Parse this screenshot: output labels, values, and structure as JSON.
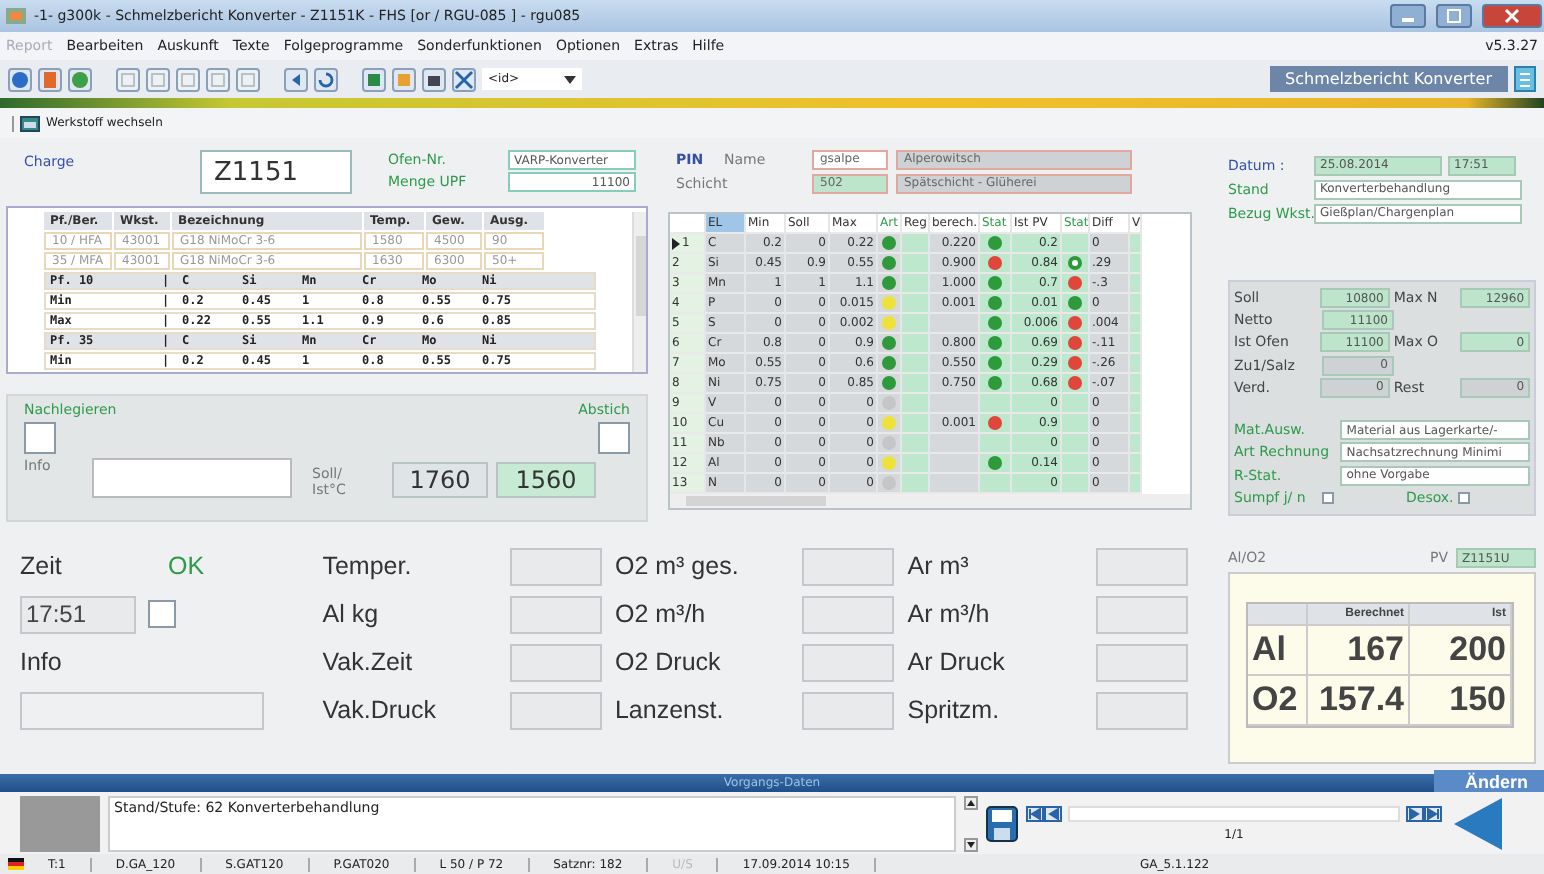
{
  "window": {
    "title": "-1- g300k - Schmelzbericht Konverter - Z1151K -   FHS [or / RGU-085 ]  -  rgu085",
    "version": "v5.3.27"
  },
  "menu": [
    {
      "label": "Report",
      "disabled": true
    },
    {
      "label": "Bearbeiten",
      "disabled": false
    },
    {
      "label": "Auskunft",
      "disabled": false
    },
    {
      "label": "Texte",
      "disabled": false
    },
    {
      "label": "Folgeprogramme",
      "disabled": false
    },
    {
      "label": "Sonderfunktionen",
      "disabled": false
    },
    {
      "label": "Optionen",
      "disabled": false
    },
    {
      "label": "Extras",
      "disabled": false
    },
    {
      "label": "Hilfe",
      "disabled": false
    }
  ],
  "toolbar": {
    "id_field": "<id>",
    "module_title": "Schmelzbericht Konverter"
  },
  "werkstoff_button": "Werkstoff wechseln",
  "charge": {
    "label": "Charge",
    "value": "Z1151",
    "ofen_label": "Ofen-Nr.",
    "ofen": "VARP-Konverter",
    "menge_label": "Menge UPF",
    "menge": "11100"
  },
  "spec_table": {
    "columns": [
      "Pf./Ber.",
      "Wkst.",
      "Bezeichnung",
      "Temp.",
      "Gew.",
      "Ausg."
    ],
    "rows": [
      [
        "10 / HFA",
        "43001",
        "G18 NiMoCr 3-6",
        "1580",
        "4500",
        "90"
      ],
      [
        "35 / MFA",
        "43001",
        "G18 NiMoCr 3-6",
        "1630",
        "6300",
        "50+"
      ]
    ]
  },
  "analysis_lines": [
    {
      "kind": "header",
      "label": "Pf. 10",
      "divider": "|",
      "values": [
        "C",
        "Si",
        "Mn",
        "Cr",
        "Mo",
        "Ni"
      ]
    },
    {
      "kind": "value",
      "label": "Min",
      "divider": "|",
      "values": [
        "0.2",
        "0.45",
        "1",
        "0.8",
        "0.55",
        "0.75"
      ]
    },
    {
      "kind": "value",
      "label": "Max",
      "divider": "|",
      "values": [
        "0.22",
        "0.55",
        "1.1",
        "0.9",
        "0.6",
        "0.85"
      ]
    },
    {
      "kind": "header",
      "label": "Pf. 35",
      "divider": "|",
      "values": [
        "C",
        "Si",
        "Mn",
        "Cr",
        "Mo",
        "Ni"
      ]
    },
    {
      "kind": "value",
      "label": "Min",
      "divider": "|",
      "values": [
        "0.2",
        "0.45",
        "1",
        "0.8",
        "0.55",
        "0.75"
      ]
    }
  ],
  "alloy_panel": {
    "nachlegieren": "Nachlegieren",
    "nachlegieren_checked": false,
    "abstich": "Abstich",
    "abstich_checked": false,
    "info_label": "Info",
    "temp_label_1": "Soll/",
    "temp_label_2": "Ist°C",
    "soll": "1760",
    "ist": "1560"
  },
  "pin": {
    "label": "PIN",
    "name_label": "Name",
    "user": "gsalpe",
    "name": "Alperowitsch",
    "schicht_label": "Schicht",
    "schicht_code": "502",
    "schicht": "Spätschicht - Glüherei"
  },
  "grid": {
    "columns": [
      "EL",
      "Min",
      "Soll",
      "Max",
      "Art",
      "Reg",
      "berech.",
      "Stat",
      "Ist PV",
      "Stat",
      "Diff",
      "V"
    ],
    "rows": [
      {
        "no": "1",
        "el": "C",
        "min": "0.2",
        "soll": "0",
        "max": "0.22",
        "art_lamp": {
          "color": "#2e9a3c",
          "hollow": false
        },
        "berech": "0.220",
        "calc_lamp": {
          "color": "#2e9a3c",
          "hollow": false
        },
        "ist": "0.2",
        "diff": "0",
        "current": true
      },
      {
        "no": "2",
        "el": "Si",
        "min": "0.45",
        "soll": "0.9",
        "max": "0.55",
        "art_lamp": {
          "color": "#2e9a3c",
          "hollow": false
        },
        "berech": "0.900",
        "calc_lamp": {
          "color": "#e0463c",
          "hollow": false
        },
        "ist": "0.84",
        "pv_lamp": {
          "color": "#2e9a3c",
          "hollow": true
        },
        "diff": ".29",
        "current": false
      },
      {
        "no": "3",
        "el": "Mn",
        "min": "1",
        "soll": "1",
        "max": "1.1",
        "art_lamp": {
          "color": "#2e9a3c",
          "hollow": false
        },
        "berech": "1.000",
        "calc_lamp": {
          "color": "#2e9a3c",
          "hollow": false
        },
        "ist": "0.7",
        "pv_lamp": {
          "color": "#e0463c",
          "hollow": false
        },
        "diff": "-.3",
        "current": false
      },
      {
        "no": "4",
        "el": "P",
        "min": "0",
        "soll": "0",
        "max": "0.015",
        "art_lamp": {
          "color": "#ece23a",
          "hollow": false
        },
        "berech": "0.001",
        "calc_lamp": {
          "color": "#2e9a3c",
          "hollow": false
        },
        "ist": "0.01",
        "pv_lamp": {
          "color": "#2e9a3c",
          "hollow": false
        },
        "diff": "0",
        "current": false
      },
      {
        "no": "5",
        "el": "S",
        "min": "0",
        "soll": "0",
        "max": "0.002",
        "art_lamp": {
          "color": "#ece23a",
          "hollow": false
        },
        "calc_lamp": {
          "color": "#2e9a3c",
          "hollow": false
        },
        "ist": "0.006",
        "pv_lamp": {
          "color": "#e0463c",
          "hollow": false
        },
        "diff": ".004",
        "current": false
      },
      {
        "no": "6",
        "el": "Cr",
        "min": "0.8",
        "soll": "0",
        "max": "0.9",
        "art_lamp": {
          "color": "#2e9a3c",
          "hollow": false
        },
        "berech": "0.800",
        "calc_lamp": {
          "color": "#2e9a3c",
          "hollow": false
        },
        "ist": "0.69",
        "pv_lamp": {
          "color": "#e0463c",
          "hollow": false
        },
        "diff": "-.11",
        "current": false
      },
      {
        "no": "7",
        "el": "Mo",
        "min": "0.55",
        "soll": "0",
        "max": "0.6",
        "art_lamp": {
          "color": "#2e9a3c",
          "hollow": false
        },
        "berech": "0.550",
        "calc_lamp": {
          "color": "#2e9a3c",
          "hollow": false
        },
        "ist": "0.29",
        "pv_lamp": {
          "color": "#e0463c",
          "hollow": false
        },
        "diff": "-.26",
        "current": false
      },
      {
        "no": "8",
        "el": "Ni",
        "min": "0.75",
        "soll": "0",
        "max": "0.85",
        "art_lamp": {
          "color": "#2e9a3c",
          "hollow": false
        },
        "berech": "0.750",
        "calc_lamp": {
          "color": "#2e9a3c",
          "hollow": false
        },
        "ist": "0.68",
        "pv_lamp": {
          "color": "#e0463c",
          "hollow": false
        },
        "diff": "-.07",
        "current": false
      },
      {
        "no": "9",
        "el": "V",
        "min": "0",
        "soll": "0",
        "max": "0",
        "art_lamp": {
          "color": "#c6c6c6",
          "hollow": false
        },
        "ist": "0",
        "diff": "0",
        "current": false
      },
      {
        "no": "10",
        "el": "Cu",
        "min": "0",
        "soll": "0",
        "max": "0",
        "art_lamp": {
          "color": "#ece23a",
          "hollow": false
        },
        "berech": "0.001",
        "calc_lamp": {
          "color": "#e0463c",
          "hollow": false
        },
        "ist": "0.9",
        "diff": "0",
        "current": false
      },
      {
        "no": "11",
        "el": "Nb",
        "min": "0",
        "soll": "0",
        "max": "0",
        "art_lamp": {
          "color": "#c6c6c6",
          "hollow": false
        },
        "ist": "0",
        "diff": "0",
        "current": false
      },
      {
        "no": "12",
        "el": "Al",
        "min": "0",
        "soll": "0",
        "max": "0",
        "art_lamp": {
          "color": "#ece23a",
          "hollow": false
        },
        "calc_lamp": {
          "color": "#2e9a3c",
          "hollow": false
        },
        "ist": "0.14",
        "diff": "0",
        "current": false
      },
      {
        "no": "13",
        "el": "N",
        "min": "0",
        "soll": "0",
        "max": "0",
        "art_lamp": {
          "color": "#c6c6c6",
          "hollow": false
        },
        "ist": "0",
        "diff": "0",
        "current": false
      }
    ]
  },
  "header_fields": {
    "datum_label": "Datum :",
    "datum": "25.08.2014",
    "zeit": "17:51",
    "stand_label": "Stand",
    "stand": "Konverterbehandlung",
    "bezug_label": "Bezug Wkst.",
    "bezug": "Gießplan/Chargenplan"
  },
  "weights": [
    {
      "label": "Soll",
      "value": "10800",
      "active": true,
      "label2": "Max N",
      "value2": "12960",
      "active2": true
    },
    {
      "label": "Netto",
      "value": "11100",
      "active": true
    },
    {
      "label": "Ist Ofen",
      "value": "11100",
      "active": true,
      "label2": "Max O",
      "value2": "0",
      "active2": true
    },
    {
      "label": "Zu1/Salz",
      "value": "0",
      "active": false
    },
    {
      "label": "Verd.",
      "value": "0",
      "active": false,
      "label2": "Rest",
      "value2": "0",
      "active2": false
    }
  ],
  "options": [
    {
      "label": "Mat.Ausw.",
      "value": "Material aus Lagerkarte/-"
    },
    {
      "label": "Art Rechnung",
      "value": "Nachsatzrechnung Minimi"
    },
    {
      "label": "R-Stat.",
      "value": "ohne Vorgabe"
    }
  ],
  "sumpf": {
    "label": "Sumpf j/ n",
    "checked": false
  },
  "desox": {
    "label": "Desox.",
    "checked": false
  },
  "alo2": {
    "label": "Al/O2",
    "pv_label": "PV",
    "pv": "Z1151U",
    "columns": [
      "",
      "Berechnet",
      "Ist"
    ],
    "rows": [
      [
        "Al",
        "167",
        "200"
      ],
      [
        "O2",
        "157.4",
        "150"
      ]
    ]
  },
  "process": {
    "zeit_label": "Zeit",
    "zeit": "17:51",
    "ok_label": "OK",
    "ok_checked": false,
    "info_label": "Info",
    "columns": [
      [
        "Temper.",
        "Al kg",
        "Vak.Zeit",
        "Vak.Druck"
      ],
      [
        "O2 m³ ges.",
        "O2 m³/h",
        "O2 Druck",
        "Lanzenst."
      ],
      [
        "Ar m³",
        "Ar m³/h",
        "Ar Druck",
        "Spritzm."
      ]
    ]
  },
  "vorgang": {
    "title": "Vorgangs-Daten",
    "aendern": "Ändern",
    "text": "Stand/Stufe: 62 Konverterbehandlung",
    "pager": "1/1"
  },
  "status_bar": [
    {
      "text": "T:1",
      "disabled": false
    },
    {
      "text": "D.GA_120",
      "disabled": false
    },
    {
      "text": "S.GAT120",
      "disabled": false
    },
    {
      "text": "P.GAT020",
      "disabled": false
    },
    {
      "text": "L 50 / P 72",
      "disabled": false
    },
    {
      "text": "Satznr: 182",
      "disabled": false
    },
    {
      "text": "U/S",
      "disabled": true
    },
    {
      "text": "17.09.2014  10:15",
      "disabled": false
    },
    {
      "text": "GA_5.1.122",
      "disabled": false
    }
  ]
}
